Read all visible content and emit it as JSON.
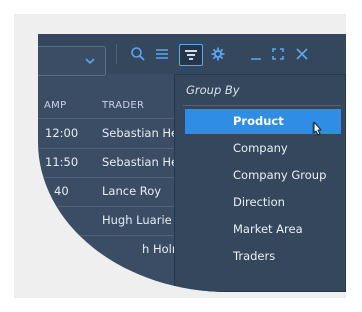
{
  "table": {
    "headers": {
      "timestamp": "AMP",
      "trader": "TRADER"
    },
    "rows": [
      {
        "time": "12:00",
        "trader": "Sebastian He"
      },
      {
        "time": "11:50",
        "trader": "Sebastian He"
      },
      {
        "time": "40",
        "trader": "Lance Roy"
      },
      {
        "time": "",
        "trader": "Hugh Luarie"
      },
      {
        "time": "",
        "trader": "h Holmes"
      }
    ]
  },
  "toolbar": {
    "icons": [
      "chevron-down-icon",
      "search-icon",
      "menu-icon",
      "filter-icon",
      "gear-icon",
      "minimize-icon",
      "maximize-icon",
      "close-icon"
    ]
  },
  "group_by_menu": {
    "title": "Group By",
    "items": [
      {
        "label": "Product",
        "selected": true
      },
      {
        "label": "Company",
        "selected": false
      },
      {
        "label": "Company Group",
        "selected": false
      },
      {
        "label": "Direction",
        "selected": false
      },
      {
        "label": "Market Area",
        "selected": false
      },
      {
        "label": "Traders",
        "selected": false
      }
    ]
  },
  "colors": {
    "panel": "#3a4d64",
    "toolbar": "#34475d",
    "accent": "#5aa7ec",
    "selection": "#2f8de6",
    "text": "#e8edf3",
    "backdrop": "#efefef"
  }
}
